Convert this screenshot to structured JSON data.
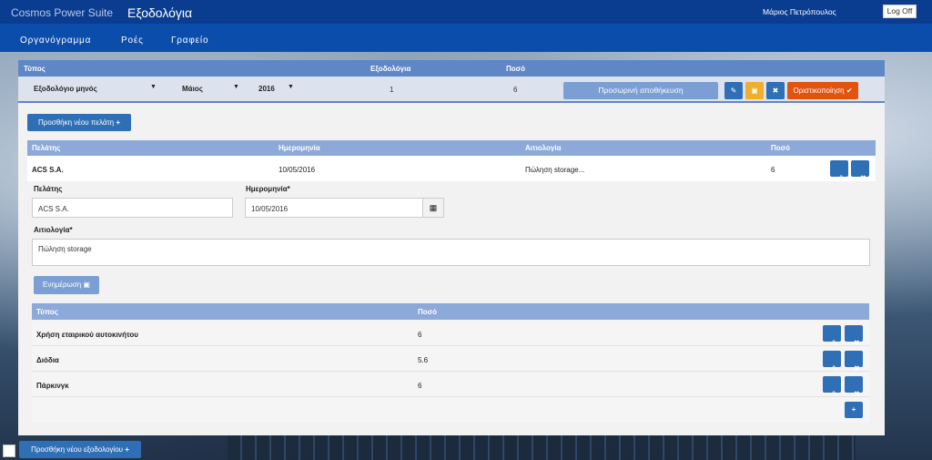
{
  "topbar": {
    "app_name": "Cosmos Power Suite",
    "page_name": "Εξοδολόγια",
    "user": "Μάριος Πετρόπουλος",
    "logoff_label": "Log Off"
  },
  "nav": {
    "items": [
      {
        "label": "Οργανόγραμμα"
      },
      {
        "label": "Ροές"
      },
      {
        "label": "Γραφείο"
      }
    ]
  },
  "summary": {
    "headers": {
      "type": "Τύπος",
      "expense_reports": "Εξοδολόγια",
      "amount": "Ποσό"
    },
    "type_value": "Εξοδολόγιο μηνός",
    "month_value": "Μάιος",
    "year_value": "2016",
    "expense_reports_value": "1",
    "amount_value": "6",
    "temp_save_label": "Προσωρινή αποθήκευση",
    "finalize_label": "Οριστικοποίηση"
  },
  "add_customer_label": "Προσθήκη νέου πελάτη",
  "customers": {
    "headers": {
      "customer": "Πελάτης",
      "date": "Ημερομηνία",
      "reason": "Αιτιολογία",
      "amount": "Ποσό"
    },
    "rows": [
      {
        "customer": "ACS S.A.",
        "date": "10/05/2016",
        "reason": "Πώληση storage...",
        "amount": "6"
      }
    ]
  },
  "form": {
    "customer_label": "Πελάτης",
    "customer_value": "ACS S.A.",
    "date_label": "Ημερομηνία*",
    "date_value": "10/05/2016",
    "reason_label": "Αιτιολογία*",
    "reason_value": "Πώληση storage",
    "update_label": "Ενημέρωση"
  },
  "expenses": {
    "headers": {
      "type": "Τύπος",
      "amount": "Ποσό"
    },
    "rows": [
      {
        "type": "Χρήση εταιρικού αυτοκινήτου",
        "amount": "6"
      },
      {
        "type": "Διόδια",
        "amount": "5.6"
      },
      {
        "type": "Πάρκινγκ",
        "amount": "6"
      }
    ]
  },
  "add_expense_report_label": "Προσθήκη νέου εξοδολογίου",
  "icons": {
    "plus": "+",
    "edit": "✎",
    "save": "💾",
    "close": "✖",
    "check": "✔",
    "caret": "▼",
    "calendar": "▦"
  },
  "colors": {
    "topbar": "#0a3d8f",
    "navbar": "#0b4dab",
    "accent": "#2f6fb5",
    "warning": "#f0ad2e",
    "danger": "#e2530f",
    "table_header": "#8ca9da"
  }
}
